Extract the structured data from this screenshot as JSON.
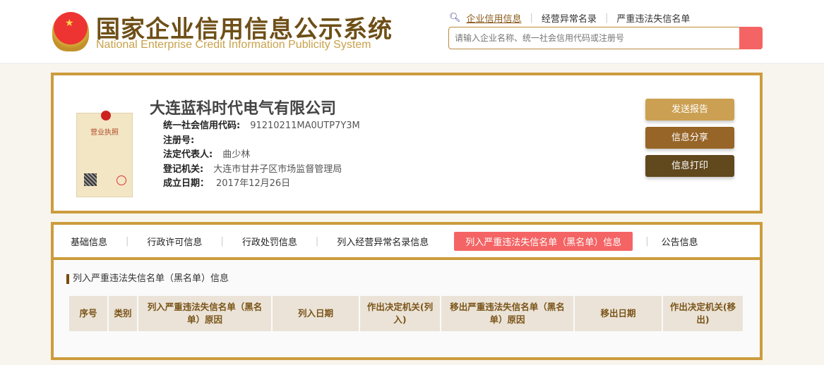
{
  "header": {
    "title_cn": "国家企业信用信息公示系统",
    "title_en": "National Enterprise Credit Information Publicity System",
    "nav": [
      "企业信用信息",
      "经营异常名录",
      "严重违法失信名单"
    ],
    "search_placeholder": "请输入企业名称、统一社会信用代码或注册号"
  },
  "company": {
    "name": "大连蓝科时代电气有限公司",
    "license_label": "营业执照",
    "fields": [
      {
        "label": "统一社会信用代码:",
        "value": "91210211MA0UTP7Y3M"
      },
      {
        "label": "注册号:",
        "value": ""
      },
      {
        "label": "法定代表人:",
        "value": "曲少林"
      },
      {
        "label": "登记机关:",
        "value": "大连市甘井子区市场监督管理局"
      },
      {
        "label": "成立日期：",
        "value": "2017年12月26日"
      }
    ]
  },
  "actions": [
    {
      "label": "发送报告",
      "color": "#cca052"
    },
    {
      "label": "信息分享",
      "color": "#976527"
    },
    {
      "label": "信息打印",
      "color": "#61481d"
    }
  ],
  "tabs": [
    "基础信息",
    "行政许可信息",
    "行政处罚信息",
    "列入经营异常名录信息",
    "列入严重违法失信名单（黑名单）信息",
    "公告信息"
  ],
  "section_title": "列入严重违法失信名单（黑名单）信息",
  "table_headers": [
    "序号",
    "类别",
    "列入严重违法失信名单（黑名单）原因",
    "列入日期",
    "作出决定机关(列入)",
    "移出严重违法失信名单（黑名单）原因",
    "移出日期",
    "作出决定机关(移出)"
  ]
}
